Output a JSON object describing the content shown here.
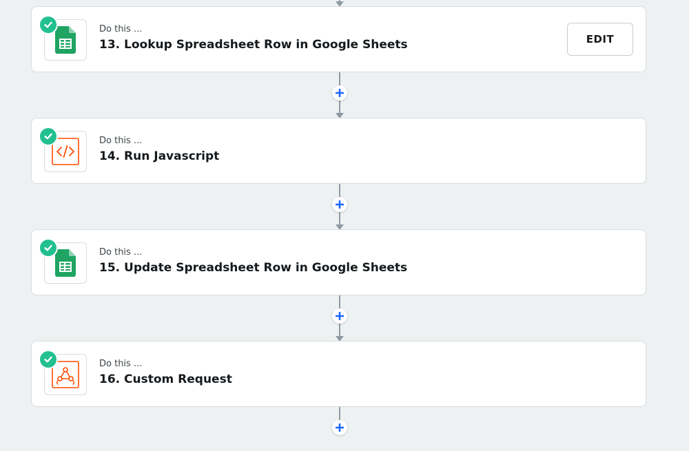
{
  "colors": {
    "background": "#eef1f2",
    "check": "#22c08f",
    "sheets_green": "#1fa463",
    "code_orange": "#ff4a00",
    "plus_blue": "#1a66ff",
    "connector": "#8e9aa2"
  },
  "steps": [
    {
      "prefix": "Do this ...",
      "title": "13. Lookup Spreadsheet Row in Google Sheets",
      "icon": "google-sheets-icon",
      "status_icon": "check-circle-icon",
      "edit_label": "EDIT"
    },
    {
      "prefix": "Do this ...",
      "title": "14. Run Javascript",
      "icon": "code-icon",
      "status_icon": "check-circle-icon"
    },
    {
      "prefix": "Do this ...",
      "title": "15. Update Spreadsheet Row in Google Sheets",
      "icon": "google-sheets-icon",
      "status_icon": "check-circle-icon"
    },
    {
      "prefix": "Do this ...",
      "title": "16. Custom Request",
      "icon": "webhook-icon",
      "status_icon": "check-circle-icon"
    }
  ],
  "add_step_icon": "plus-icon"
}
